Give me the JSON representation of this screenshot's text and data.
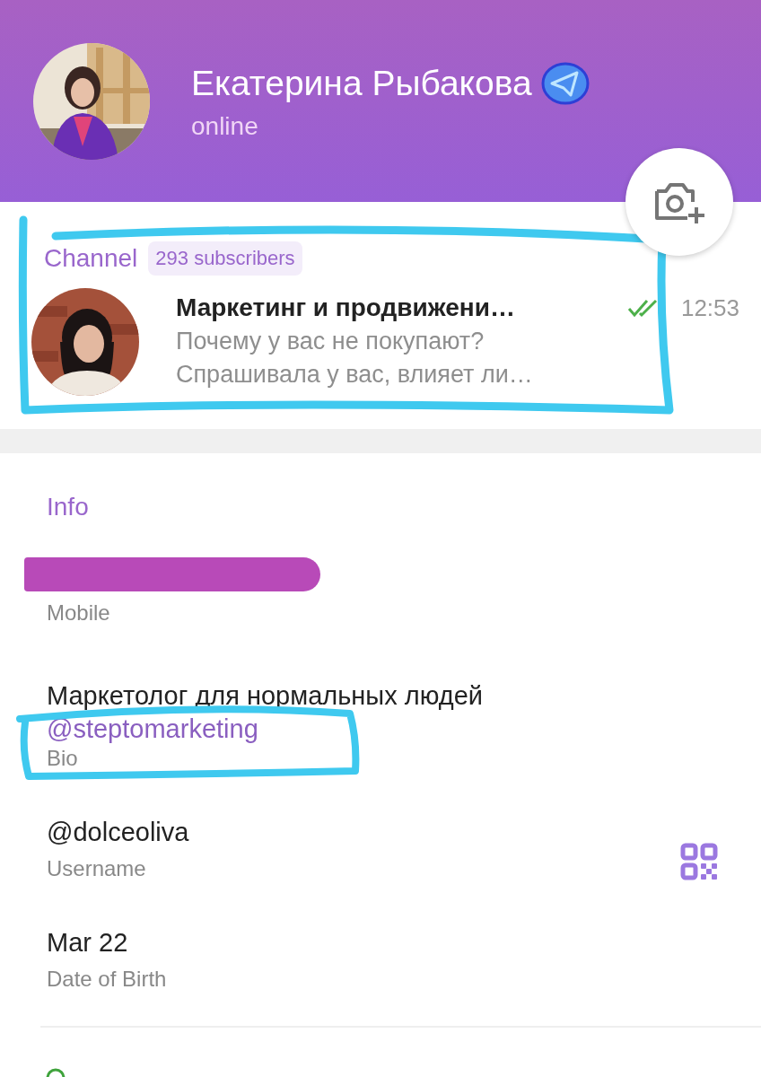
{
  "header": {
    "name": "Екатерина Рыбакова",
    "status": "online",
    "verified": true
  },
  "channel": {
    "label": "Channel",
    "subscribers": "293 subscribers",
    "title": "Маркетинг и продвижени…",
    "preview_lines": [
      "Почему у вас не покупают?",
      "Спрашивала у вас, влияет ли…"
    ],
    "read": true,
    "time": "12:53",
    "highlighted": true
  },
  "info": {
    "heading": "Info",
    "items": [
      {
        "kind": "phone",
        "redacted": true,
        "label": "Mobile"
      },
      {
        "kind": "bio",
        "value": "Маркетолог для нормальных людей",
        "link": "@steptomarketing",
        "link_highlighted": true,
        "label": "Bio"
      },
      {
        "kind": "username",
        "value": "@dolceoliva",
        "label": "Username",
        "qr": true
      },
      {
        "kind": "date",
        "value": "Mar 22",
        "label": "Date of Birth"
      }
    ]
  }
}
